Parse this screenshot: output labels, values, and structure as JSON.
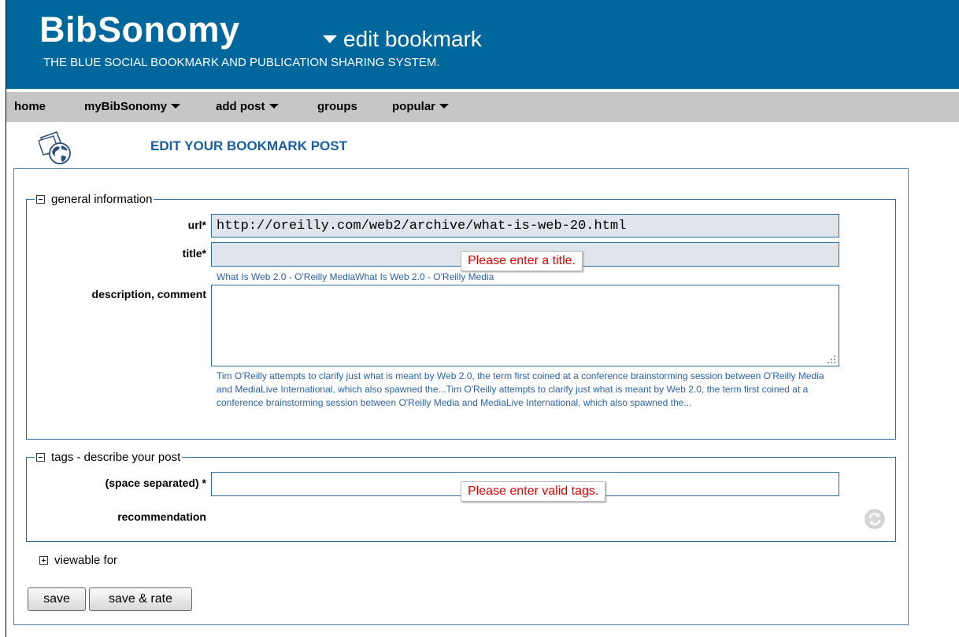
{
  "header": {
    "brand": "BibSonomy",
    "page_heading": "edit bookmark",
    "tagline": "THE BLUE SOCIAL BOOKMARK AND PUBLICATION SHARING SYSTEM."
  },
  "nav": {
    "items": [
      {
        "label": "home"
      },
      {
        "label": "myBibSonomy"
      },
      {
        "label": "add post"
      },
      {
        "label": "groups"
      },
      {
        "label": "popular"
      }
    ]
  },
  "form": {
    "title": "EDIT YOUR BOOKMARK POST",
    "general": {
      "legend": "general information",
      "url_label": "url*",
      "url_value": "http://oreilly.com/web2/archive/what-is-web-20.html",
      "title_label": "title*",
      "title_value": "",
      "title_error": "Please enter a title.",
      "title_suggestion": "What Is Web 2.0 - O'Reilly MediaWhat Is Web 2.0 - O'Reilly Media",
      "description_label": "description, comment",
      "description_value": "",
      "description_suggestion": "Tim O'Reilly attempts to clarify just what is meant by Web 2.0, the term first coined at a conference brainstorming session between O'Reilly Media and MediaLive International, which also spawned the...Tim O'Reilly attempts to clarify just what is meant by Web 2.0, the term first coined at a conference brainstorming session between O'Reilly Media and MediaLive International, which also spawned the..."
    },
    "tags": {
      "legend": "tags - describe your post",
      "tags_label": "(space separated) *",
      "tags_value": "",
      "tags_error": "Please enter valid tags.",
      "recommendation_label": "recommendation"
    },
    "viewable_for": "viewable for",
    "buttons": {
      "save": "save",
      "save_rate": "save & rate"
    }
  },
  "colors": {
    "header_bg": "#00679c",
    "nav_bg": "#c6c6c6",
    "accent": "#1a5ea0",
    "error": "#e10000",
    "input_bg": "#dfe5ea"
  },
  "icons": [
    "bookmark-globe-icon",
    "refresh-icon",
    "collapse-icon",
    "expand-icon",
    "chevron-down-icon"
  ]
}
